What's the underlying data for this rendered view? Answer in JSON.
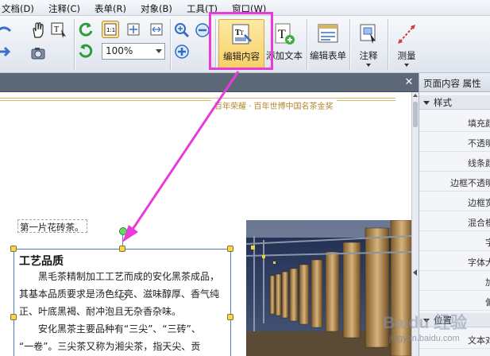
{
  "menu": {
    "items": [
      "文档(D)",
      "注释(C)",
      "表单(R)",
      "对象(B)",
      "工具(T)",
      "窗口(W)"
    ]
  },
  "toolbar": {
    "zoom_value": "100%",
    "edit_content_label": "编辑内容",
    "add_text_label": "添加文本",
    "edit_form_label": "编辑表单",
    "annotate_label": "注释",
    "measure_label": "测量"
  },
  "document": {
    "header_slogan": "百年荣耀 · 百年世博中国名茶金奖",
    "caption_text": "第一片花砖茶。",
    "section_title": "工艺品质",
    "paragraphs": [
      "黑毛茶精制加工工艺而成的安化黑茶成品，",
      "其基本品质要求是汤色红亮、滋味醇厚、香气纯",
      "正、叶底黑褐、耐冲泡且无杂香杂味。",
      "安化黑茶主要品种有“三尖”、“三砖”、",
      "“一卷”。三尖茶又称为湘尖茶，指天尖、贡"
    ]
  },
  "panel": {
    "title": "页面内容 属性",
    "group_style": "样式",
    "group_position": "位置",
    "properties": [
      "填充颜",
      "不透明",
      "线条颜",
      "边框不透明",
      "边框宽",
      "混合模",
      "字",
      "字体大",
      "加",
      "偏"
    ],
    "position_prop": "文本对"
  },
  "watermark": {
    "brand": "Baidu 经验",
    "url": "jingyan.baidu.com"
  },
  "colors": {
    "highlight": "#e83bd9",
    "active_button": "#f8cf64",
    "selection": "#4a7fd0"
  }
}
